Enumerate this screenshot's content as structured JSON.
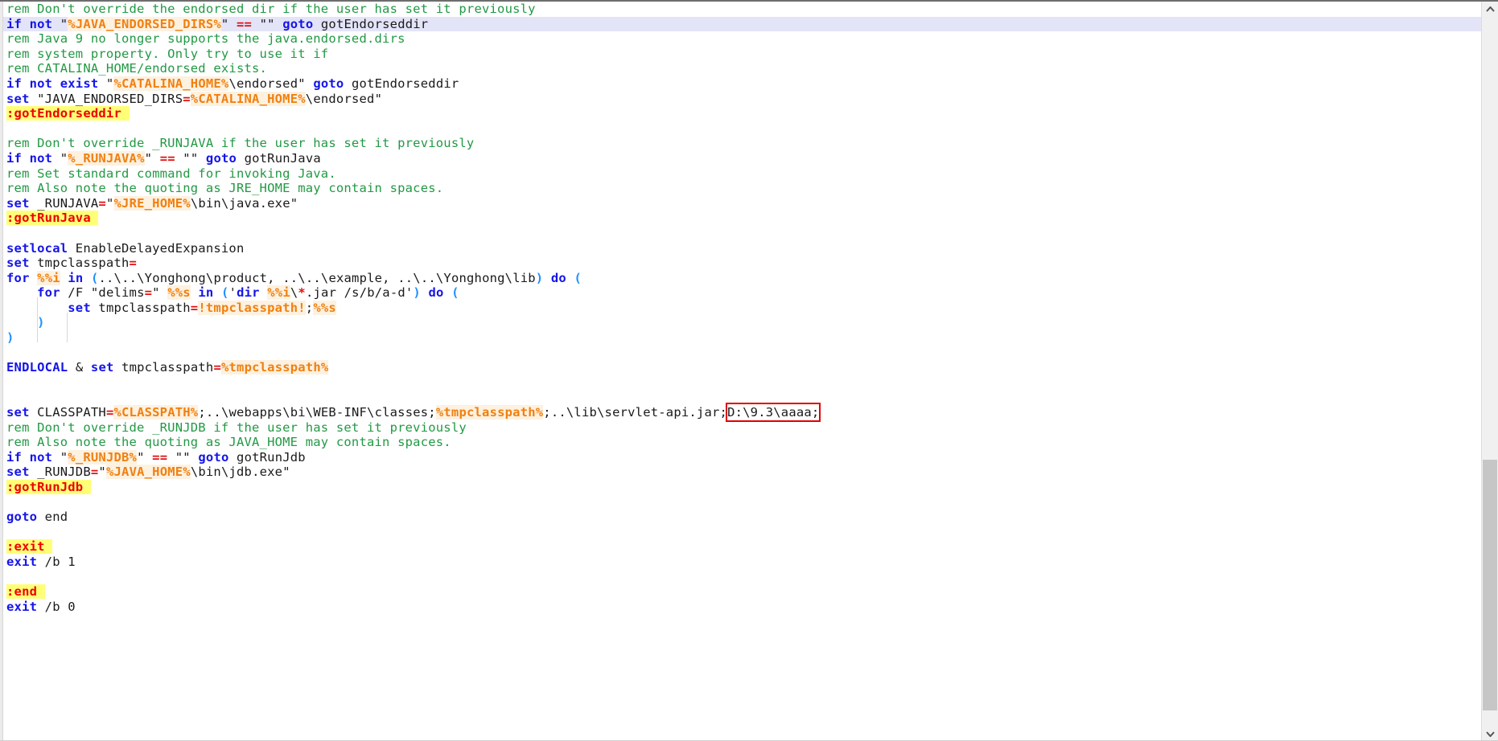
{
  "app": {
    "kind": "code-editor",
    "language": "Windows Batch / CMD script",
    "colors": {
      "keyword": "#1515e8",
      "comment": "#229944",
      "variable": "#f08010",
      "variable_bg": "#fdf1e0",
      "operator": "#e01010",
      "label_text": "#ee0000",
      "label_bg": "#ffff77",
      "paren": "#1e90ff",
      "plain_text": "#1a1a1a",
      "active_line_bg": "#e4e4f8",
      "editor_bg": "#ffffff",
      "gutter_bg": "#ebebeb",
      "scrollbar_track": "#f0f0f0",
      "scrollbar_thumb": "#c6c6c6",
      "annotation_box": "#e00000"
    }
  },
  "scrollbar": {
    "up_arrow_name": "chevron-up-icon",
    "down_arrow_name": "chevron-down-icon",
    "thumb_name": "vertical-scrollbar-thumb"
  },
  "annotation": {
    "boxed_text": "D:\\9.3\\aaaa;",
    "box_color": "#e00000"
  },
  "code": {
    "active_line_index": 1,
    "lines": [
      {
        "n": 1,
        "tokens": [
          {
            "t": "cmt",
            "v": "rem Don't override the endorsed dir if the user has set it previously"
          }
        ]
      },
      {
        "n": 2,
        "active": true,
        "tokens": [
          {
            "t": "kw",
            "v": "if not"
          },
          {
            "t": "plain",
            "v": " \""
          },
          {
            "t": "var",
            "v": "%JAVA_ENDORSED_DIRS%"
          },
          {
            "t": "plain",
            "v": "\" "
          },
          {
            "t": "op",
            "v": "=="
          },
          {
            "t": "plain",
            "v": " \"\" "
          },
          {
            "t": "kw",
            "v": "goto"
          },
          {
            "t": "plain",
            "v": " gotEndorseddir"
          }
        ]
      },
      {
        "n": 3,
        "tokens": [
          {
            "t": "cmt",
            "v": "rem Java 9 no longer supports the java.endorsed.dirs"
          }
        ]
      },
      {
        "n": 4,
        "tokens": [
          {
            "t": "cmt",
            "v": "rem system property. Only try to use it if"
          }
        ]
      },
      {
        "n": 5,
        "tokens": [
          {
            "t": "cmt",
            "v": "rem CATALINA_HOME/endorsed exists."
          }
        ]
      },
      {
        "n": 6,
        "tokens": [
          {
            "t": "kw",
            "v": "if not exist"
          },
          {
            "t": "plain",
            "v": " \""
          },
          {
            "t": "var",
            "v": "%CATALINA_HOME%"
          },
          {
            "t": "plain",
            "v": "\\endorsed\" "
          },
          {
            "t": "kw",
            "v": "goto"
          },
          {
            "t": "plain",
            "v": " gotEndorseddir"
          }
        ]
      },
      {
        "n": 7,
        "tokens": [
          {
            "t": "kw",
            "v": "set"
          },
          {
            "t": "plain",
            "v": " \"JAVA_ENDORSED_DIRS"
          },
          {
            "t": "op",
            "v": "="
          },
          {
            "t": "var",
            "v": "%CATALINA_HOME%"
          },
          {
            "t": "plain",
            "v": "\\endorsed\""
          }
        ]
      },
      {
        "n": 8,
        "tokens": [
          {
            "t": "label",
            "v": ":gotEndorseddir "
          }
        ]
      },
      {
        "n": 9,
        "tokens": []
      },
      {
        "n": 10,
        "tokens": [
          {
            "t": "cmt",
            "v": "rem Don't override _RUNJAVA if the user has set it previously"
          }
        ]
      },
      {
        "n": 11,
        "tokens": [
          {
            "t": "kw",
            "v": "if not"
          },
          {
            "t": "plain",
            "v": " \""
          },
          {
            "t": "var",
            "v": "%_RUNJAVA%"
          },
          {
            "t": "plain",
            "v": "\" "
          },
          {
            "t": "op",
            "v": "=="
          },
          {
            "t": "plain",
            "v": " \"\" "
          },
          {
            "t": "kw",
            "v": "goto"
          },
          {
            "t": "plain",
            "v": " gotRunJava"
          }
        ]
      },
      {
        "n": 12,
        "tokens": [
          {
            "t": "cmt",
            "v": "rem Set standard command for invoking Java."
          }
        ]
      },
      {
        "n": 13,
        "tokens": [
          {
            "t": "cmt",
            "v": "rem Also note the quoting as JRE_HOME may contain spaces."
          }
        ]
      },
      {
        "n": 14,
        "tokens": [
          {
            "t": "kw",
            "v": "set"
          },
          {
            "t": "plain",
            "v": " _RUNJAVA"
          },
          {
            "t": "op",
            "v": "="
          },
          {
            "t": "plain",
            "v": "\""
          },
          {
            "t": "var",
            "v": "%JRE_HOME%"
          },
          {
            "t": "plain",
            "v": "\\bin\\java.exe\""
          }
        ]
      },
      {
        "n": 15,
        "tokens": [
          {
            "t": "label",
            "v": ":gotRunJava "
          }
        ]
      },
      {
        "n": 16,
        "tokens": []
      },
      {
        "n": 17,
        "tokens": [
          {
            "t": "kw",
            "v": "setlocal"
          },
          {
            "t": "plain",
            "v": " EnableDelayedExpansion"
          }
        ]
      },
      {
        "n": 18,
        "tokens": [
          {
            "t": "kw",
            "v": "set"
          },
          {
            "t": "plain",
            "v": " tmpclasspath"
          },
          {
            "t": "op",
            "v": "="
          }
        ]
      },
      {
        "n": 19,
        "tokens": [
          {
            "t": "kw",
            "v": "for"
          },
          {
            "t": "plain",
            "v": " "
          },
          {
            "t": "var",
            "v": "%%i"
          },
          {
            "t": "plain",
            "v": " "
          },
          {
            "t": "kw",
            "v": "in"
          },
          {
            "t": "plain",
            "v": " "
          },
          {
            "t": "paren",
            "v": "("
          },
          {
            "t": "plain",
            "v": "..\\..\\Yonghong\\product, ..\\..\\example, ..\\..\\Yonghong\\lib"
          },
          {
            "t": "paren",
            "v": ")"
          },
          {
            "t": "plain",
            "v": " "
          },
          {
            "t": "kw",
            "v": "do"
          },
          {
            "t": "plain",
            "v": " "
          },
          {
            "t": "paren",
            "v": "("
          }
        ]
      },
      {
        "n": 20,
        "tokens": [
          {
            "t": "plain",
            "v": "    "
          },
          {
            "t": "kw",
            "v": "for"
          },
          {
            "t": "plain",
            "v": " /F \"delims"
          },
          {
            "t": "op",
            "v": "="
          },
          {
            "t": "plain",
            "v": "\" "
          },
          {
            "t": "var",
            "v": "%%s"
          },
          {
            "t": "plain",
            "v": " "
          },
          {
            "t": "kw",
            "v": "in"
          },
          {
            "t": "plain",
            "v": " "
          },
          {
            "t": "paren",
            "v": "("
          },
          {
            "t": "plain",
            "v": "'"
          },
          {
            "t": "kw",
            "v": "dir"
          },
          {
            "t": "plain",
            "v": " "
          },
          {
            "t": "var",
            "v": "%%i"
          },
          {
            "t": "plain",
            "v": "\\"
          },
          {
            "t": "op",
            "v": "*"
          },
          {
            "t": "plain",
            "v": ".jar /s/b/a-d'"
          },
          {
            "t": "paren",
            "v": ")"
          },
          {
            "t": "plain",
            "v": " "
          },
          {
            "t": "kw",
            "v": "do"
          },
          {
            "t": "plain",
            "v": " "
          },
          {
            "t": "paren",
            "v": "("
          }
        ]
      },
      {
        "n": 21,
        "tokens": [
          {
            "t": "plain",
            "v": "        "
          },
          {
            "t": "kw",
            "v": "set"
          },
          {
            "t": "plain",
            "v": " tmpclasspath"
          },
          {
            "t": "op",
            "v": "="
          },
          {
            "t": "var",
            "v": "!tmpclasspath!"
          },
          {
            "t": "plain",
            "v": ";"
          },
          {
            "t": "var",
            "v": "%%s"
          }
        ]
      },
      {
        "n": 22,
        "tokens": [
          {
            "t": "plain",
            "v": "    "
          },
          {
            "t": "paren",
            "v": ")"
          }
        ]
      },
      {
        "n": 23,
        "tokens": [
          {
            "t": "paren",
            "v": ")"
          }
        ]
      },
      {
        "n": 24,
        "tokens": []
      },
      {
        "n": 25,
        "tokens": [
          {
            "t": "endlocal",
            "v": "ENDLOCAL"
          },
          {
            "t": "plain",
            "v": " "
          },
          {
            "t": "amp",
            "v": "&"
          },
          {
            "t": "plain",
            "v": " "
          },
          {
            "t": "kw",
            "v": "set"
          },
          {
            "t": "plain",
            "v": " tmpclasspath"
          },
          {
            "t": "op",
            "v": "="
          },
          {
            "t": "var",
            "v": "%tmpclasspath%"
          }
        ]
      },
      {
        "n": 26,
        "tokens": []
      },
      {
        "n": 27,
        "tokens": []
      },
      {
        "n": 28,
        "tokens": [
          {
            "t": "kw",
            "v": "set"
          },
          {
            "t": "plain",
            "v": " CLASSPATH"
          },
          {
            "t": "op",
            "v": "="
          },
          {
            "t": "var",
            "v": "%CLASSPATH%"
          },
          {
            "t": "plain",
            "v": ";..\\webapps\\bi\\WEB-INF\\classes;"
          },
          {
            "t": "var",
            "v": "%tmpclasspath%"
          },
          {
            "t": "plain",
            "v": ";..\\lib\\servlet-api.jar;"
          },
          {
            "t": "boxed",
            "v": "D:\\9.3\\aaaa;"
          }
        ]
      },
      {
        "n": 29,
        "tokens": [
          {
            "t": "cmt",
            "v": "rem Don't override _RUNJDB if the user has set it previously"
          }
        ]
      },
      {
        "n": 30,
        "tokens": [
          {
            "t": "cmt",
            "v": "rem Also note the quoting as JAVA_HOME may contain spaces."
          }
        ]
      },
      {
        "n": 31,
        "tokens": [
          {
            "t": "kw",
            "v": "if not"
          },
          {
            "t": "plain",
            "v": " \""
          },
          {
            "t": "var",
            "v": "%_RUNJDB%"
          },
          {
            "t": "plain",
            "v": "\" "
          },
          {
            "t": "op",
            "v": "=="
          },
          {
            "t": "plain",
            "v": " \"\" "
          },
          {
            "t": "kw",
            "v": "goto"
          },
          {
            "t": "plain",
            "v": " gotRunJdb"
          }
        ]
      },
      {
        "n": 32,
        "tokens": [
          {
            "t": "kw",
            "v": "set"
          },
          {
            "t": "plain",
            "v": " _RUNJDB"
          },
          {
            "t": "op",
            "v": "="
          },
          {
            "t": "plain",
            "v": "\""
          },
          {
            "t": "var",
            "v": "%JAVA_HOME%"
          },
          {
            "t": "plain",
            "v": "\\bin\\jdb.exe\""
          }
        ]
      },
      {
        "n": 33,
        "tokens": [
          {
            "t": "label",
            "v": ":gotRunJdb "
          }
        ]
      },
      {
        "n": 34,
        "tokens": []
      },
      {
        "n": 35,
        "tokens": [
          {
            "t": "kw",
            "v": "goto"
          },
          {
            "t": "plain",
            "v": " end"
          }
        ]
      },
      {
        "n": 36,
        "tokens": []
      },
      {
        "n": 37,
        "tokens": [
          {
            "t": "label",
            "v": ":exit "
          }
        ]
      },
      {
        "n": 38,
        "tokens": [
          {
            "t": "kw",
            "v": "exit"
          },
          {
            "t": "plain",
            "v": " /b 1"
          }
        ]
      },
      {
        "n": 39,
        "tokens": []
      },
      {
        "n": 40,
        "tokens": [
          {
            "t": "label",
            "v": ":end "
          }
        ]
      },
      {
        "n": 41,
        "tokens": [
          {
            "t": "kw",
            "v": "exit"
          },
          {
            "t": "plain",
            "v": " /b 0"
          }
        ]
      },
      {
        "n": 42,
        "tokens": []
      }
    ]
  }
}
